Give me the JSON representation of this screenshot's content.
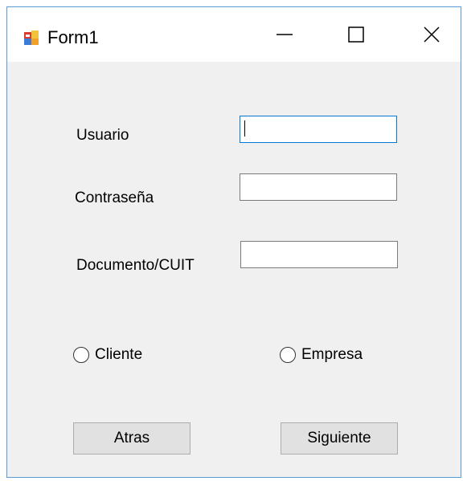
{
  "window": {
    "title": "Form1",
    "app_icon": "windows-form-icon",
    "controls": {
      "minimize_icon": "minimize-icon",
      "maximize_icon": "maximize-icon",
      "close_icon": "close-icon"
    }
  },
  "form": {
    "fields": [
      {
        "label": "Usuario",
        "value": "",
        "focused": true
      },
      {
        "label": "Contraseña",
        "value": "",
        "focused": false
      },
      {
        "label": "Documento/CUIT",
        "value": "",
        "focused": false
      }
    ],
    "radios": [
      {
        "label": "Cliente",
        "checked": false
      },
      {
        "label": "Empresa",
        "checked": false
      }
    ],
    "buttons": {
      "back_label": "Atras",
      "next_label": "Siguiente"
    }
  },
  "colors": {
    "window_border": "#5b9bd5",
    "client_bg": "#f0f0f0",
    "focus_border": "#0078d7",
    "button_bg": "#e1e1e1"
  }
}
